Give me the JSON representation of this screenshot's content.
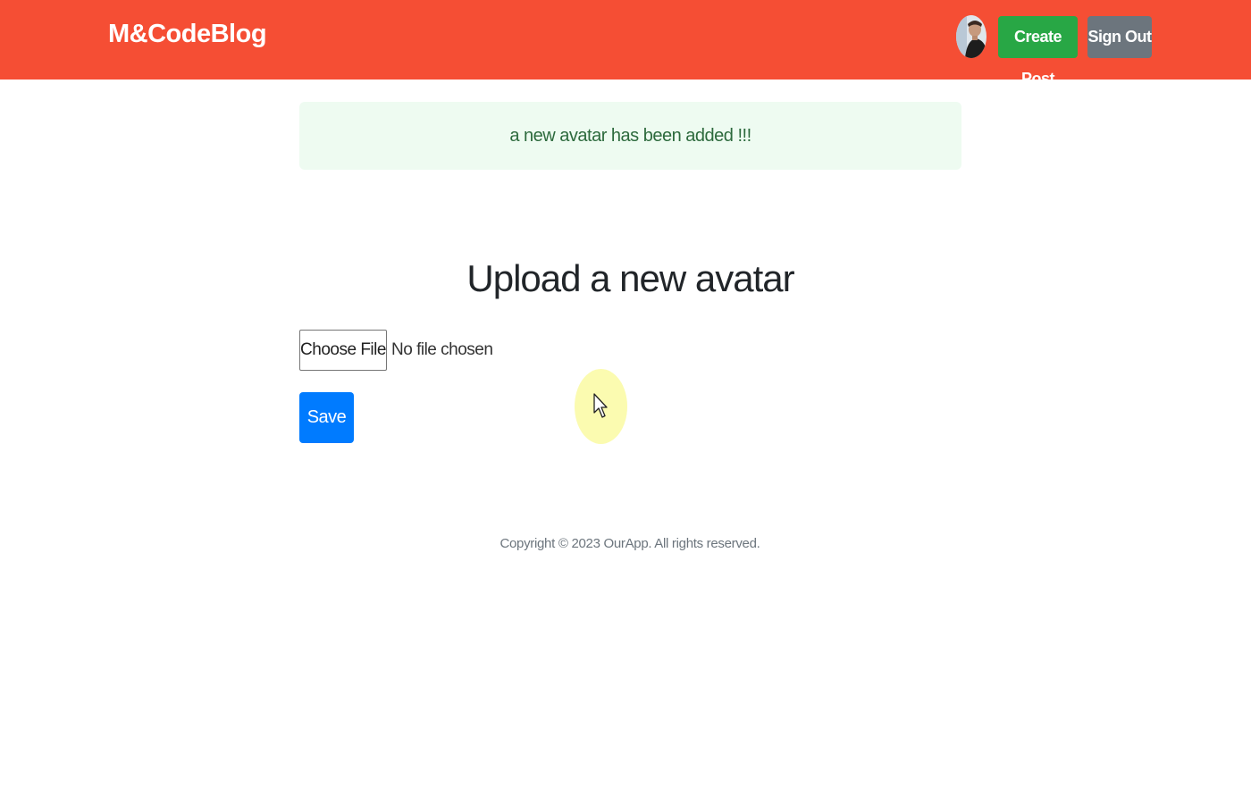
{
  "navbar": {
    "brand": "M&CodeBlog",
    "create_post_label": "Create Post",
    "sign_out_label": "Sign Out"
  },
  "alert": {
    "message": "a new avatar has been added !!!"
  },
  "main": {
    "heading": "Upload a new avatar",
    "choose_file_label": "Choose File",
    "file_status": "No file chosen",
    "save_label": "Save"
  },
  "footer": {
    "copyright": "Copyright © 2023 OurApp. All rights reserved."
  },
  "colors": {
    "navbar": "#f54e34",
    "create_post": "#28a745",
    "sign_out": "#6c757d",
    "alert_bg": "#eefbf1",
    "alert_text": "#2d6a3d",
    "save": "#007bff",
    "cursor_highlight": "#fbfbb0"
  },
  "icons": {
    "avatar": "user-avatar-photo",
    "cursor": "mouse-pointer-icon"
  }
}
